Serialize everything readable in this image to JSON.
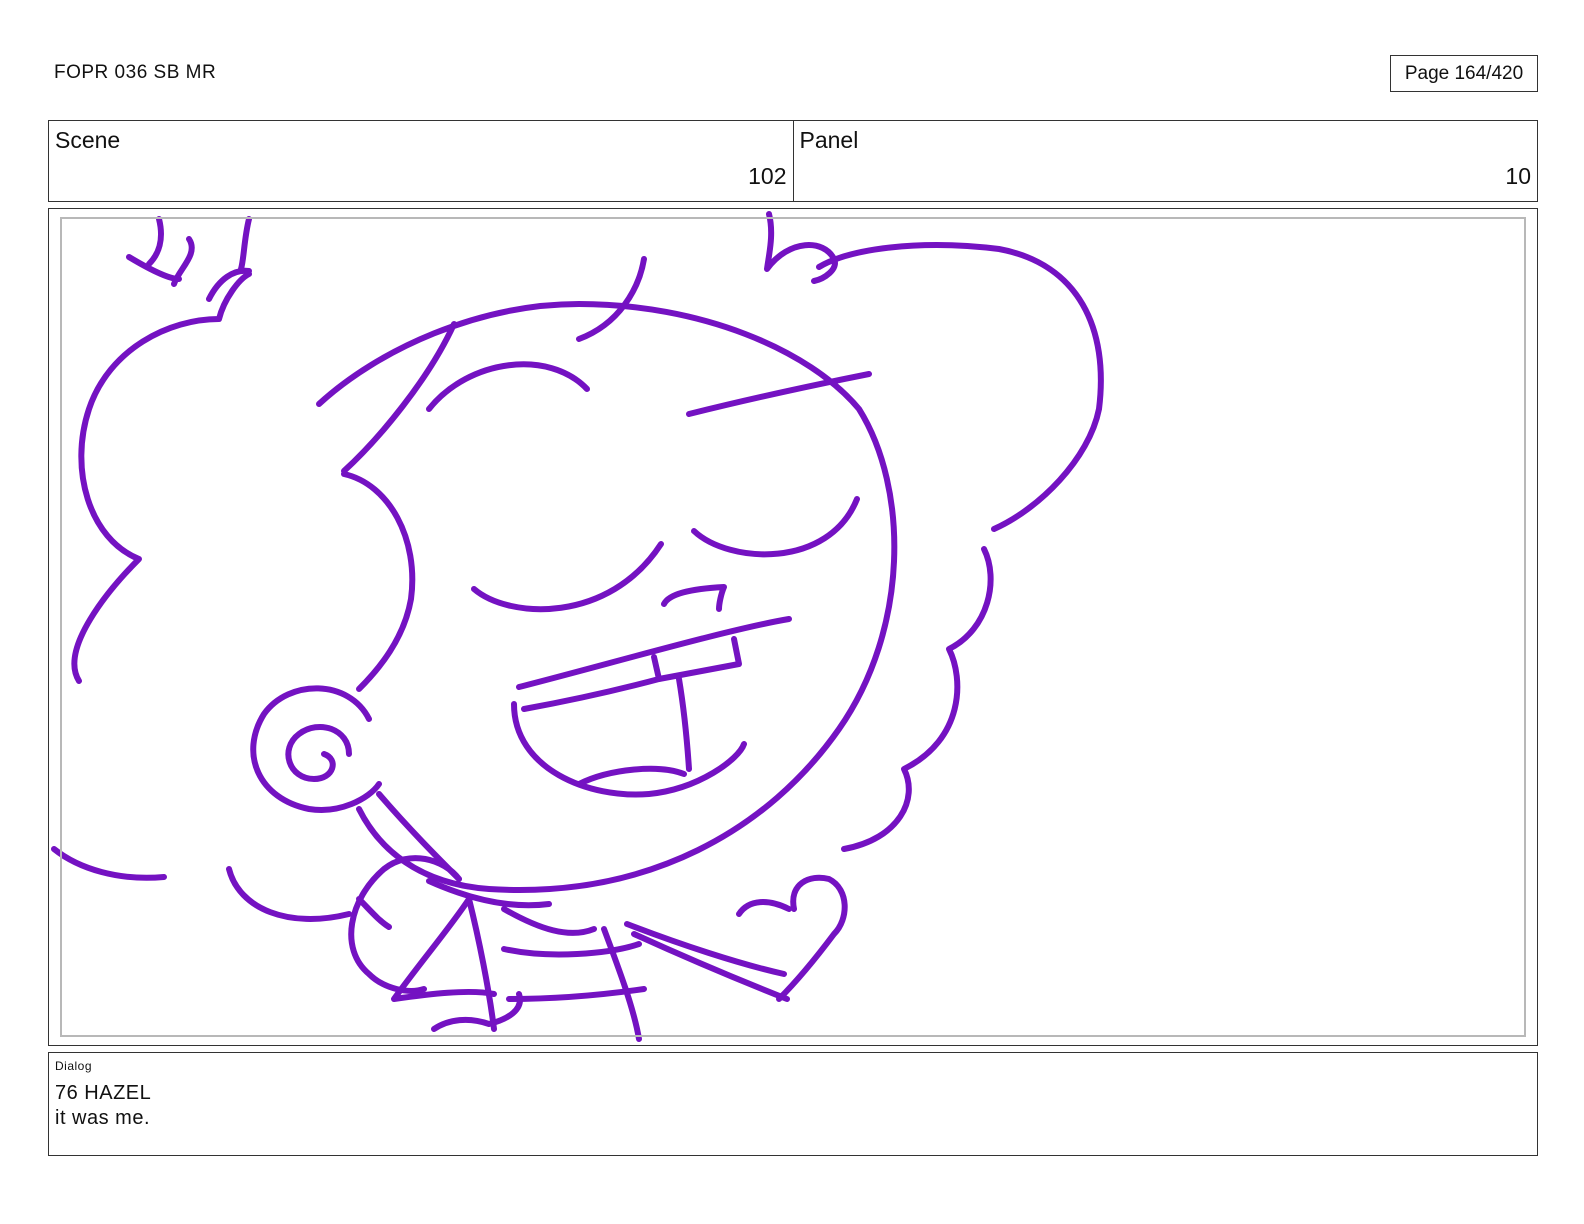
{
  "document": {
    "title": "FOPR 036 SB MR",
    "page": "Page 164/420"
  },
  "header": {
    "scene_label": "Scene",
    "scene_value": "102",
    "panel_label": "Panel",
    "panel_value": "10"
  },
  "panel_image": {
    "stroke_color": "#7412c2",
    "frame_color": "#b8b8b8"
  },
  "dialog": {
    "label": "Dialog",
    "lines": [
      "76 HAZEL",
      "it was me."
    ]
  }
}
